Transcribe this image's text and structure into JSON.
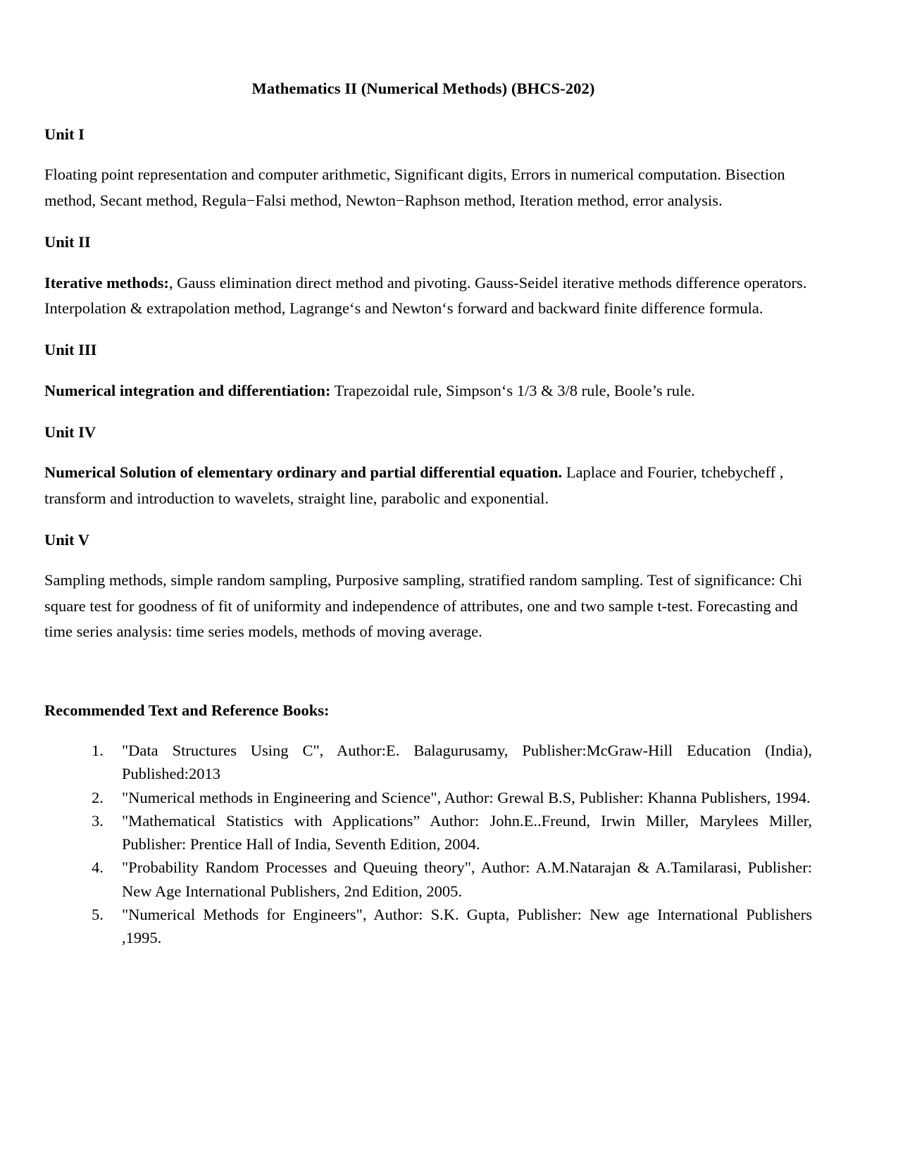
{
  "document": {
    "title": "Mathematics II (Numerical Methods)   (BHCS-202)",
    "units": [
      {
        "heading": "Unit I",
        "lead": "",
        "body": "Floating point representation and computer arithmetic, Significant digits, Errors in numerical computation. Bisection method, Secant method, Regula−Falsi method, Newton−Raphson method, Iteration method, error analysis."
      },
      {
        "heading": "Unit II",
        "lead": "Iterative methods:",
        "body": ", Gauss elimination direct method and pivoting. Gauss-Seidel iterative methods difference operators.  Interpolation & extrapolation method, Lagrange‘s and Newton‘s  forward and backward  finite difference formula."
      },
      {
        "heading": "Unit III",
        "lead": "Numerical integration and differentiation:",
        "body": " Trapezoidal rule, Simpson‘s 1/3 & 3/8 rule, Boole’s rule."
      },
      {
        "heading": "Unit IV",
        "lead": "Numerical Solution of elementary ordinary  and partial differential equation.",
        "body": " Laplace and Fourier, tchebycheff , transform and introduction to wavelets, straight line, parabolic and exponential."
      },
      {
        "heading": "Unit V",
        "lead": "",
        "body": "Sampling methods, simple random sampling, Purposive sampling, stratified random sampling. Test of significance: Chi square test for goodness of fit of uniformity and independence of attributes, one and two sample t-test. Forecasting and time series analysis: time series models, methods of moving average."
      }
    ],
    "references": {
      "heading": "Recommended Text and Reference Books:",
      "items": [
        "\"Data Structures Using C\", Author:E. Balagurusamy, Publisher:McGraw-Hill Education (India), Published:2013",
        "\"Numerical methods in Engineering and Science\", Author: Grewal B.S, Publisher: Khanna Publishers, 1994.",
        "\"Mathematical Statistics with Applications” Author: John.E..Freund, Irwin Miller, Marylees Miller, Publisher: Prentice Hall of India, Seventh Edition,  2004.",
        "\"Probability Random Processes and Queuing theory\", Author: A.M.Natarajan & A.Tamilarasi, Publisher: New Age International Publishers, 2nd Edition, 2005.",
        "\"Numerical Methods for Engineers\", Author:  S.K. Gupta, Publisher: New age International Publishers ,1995."
      ]
    }
  }
}
